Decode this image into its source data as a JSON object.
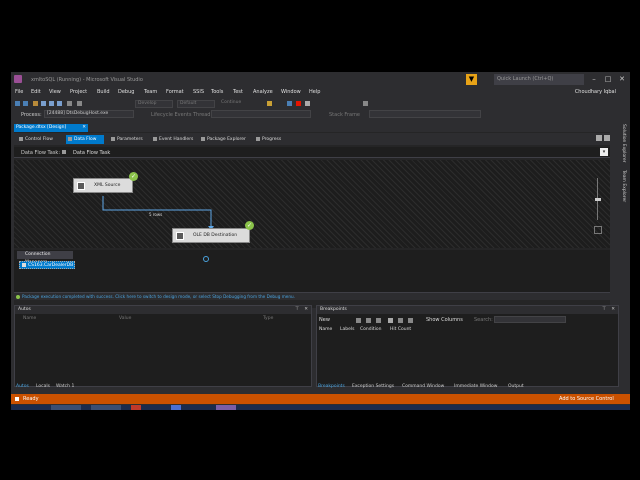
{
  "window": {
    "title": "xmltoSQL (Running) - Microsoft Visual Studio",
    "quick_launch_placeholder": "Quick Launch (Ctrl+Q)",
    "user": "Choudhary Iqbal"
  },
  "menu": [
    "File",
    "Edit",
    "View",
    "Project",
    "Build",
    "Debug",
    "Team",
    "Format",
    "SSIS",
    "Tools",
    "Test",
    "Analyze",
    "Window",
    "Help"
  ],
  "toolbar": {
    "config": "Develop",
    "platform": "Default",
    "continue": "Continue",
    "lifecycle": "Lifecycle Events",
    "thread": "Thread",
    "stack_frame": "Stack Frame",
    "process_label": "Process:",
    "process_value": "[24488] DtsDebugHost.exe"
  },
  "document": {
    "tab": "Package.dtsx [Design]",
    "designer_tabs": [
      "Control Flow",
      "Data Flow",
      "Parameters",
      "Event Handlers",
      "Package Explorer",
      "Progress"
    ],
    "active_tab": "Data Flow",
    "task_label": "Data Flow Task:",
    "task_value": "Data Flow Task"
  },
  "dataflow": {
    "source": "XML Source",
    "path_label": "5 rows",
    "destination": "OLE DB Destination"
  },
  "connection_managers": {
    "title": "Connection Managers",
    "items": [
      "CS163.CarDealerDB"
    ]
  },
  "status_message": "Package execution completed with success. Click here to switch to design mode, or select Stop Debugging from the Debug menu.",
  "autos": {
    "title": "Autos",
    "columns": [
      "Name",
      "Value",
      "Type"
    ]
  },
  "breakpoints": {
    "title": "Breakpoints",
    "new_label": "New",
    "show_columns": "Show Columns",
    "search_placeholder": "Search:",
    "columns": [
      "Name",
      "Labels",
      "Condition",
      "Hit Count"
    ]
  },
  "bottom_tabs_left": [
    "Autos",
    "Locals",
    "Watch 1"
  ],
  "bottom_tabs_right": [
    "Breakpoints",
    "Exception Settings",
    "Command Window",
    "Immediate Window",
    "Output"
  ],
  "status_bar": {
    "left": "Ready",
    "right": "Add to Source Control"
  },
  "side_panels": [
    "Solution Explorer",
    "Team Explorer"
  ],
  "colors": {
    "accent": "#007acc",
    "status_bar": "#ca5100",
    "success": "#8bc34a"
  }
}
